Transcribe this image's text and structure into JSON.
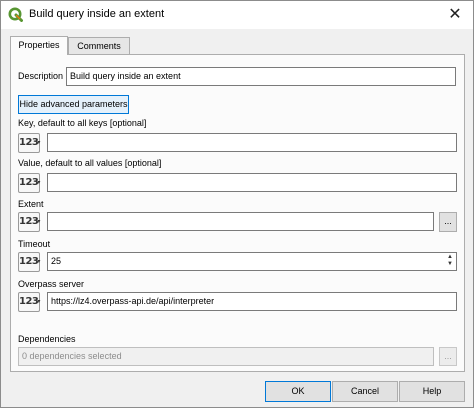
{
  "window": {
    "title": "Build query inside an extent",
    "app_icon": "qgis-logo-icon",
    "close_symbol": "✕"
  },
  "tabs": [
    {
      "label": "Properties",
      "active": true
    },
    {
      "label": "Comments",
      "active": false
    }
  ],
  "description": {
    "label": "Description",
    "value": "Build query inside an extent"
  },
  "advanced_button": {
    "label": "Hide advanced parameters"
  },
  "fields": {
    "key": {
      "label": "Key, default to all keys [optional]",
      "value": "",
      "icon": "123"
    },
    "value": {
      "label": "Value, default to all values [optional]",
      "value": "",
      "icon": "123"
    },
    "extent": {
      "label": "Extent",
      "value": "",
      "icon": "123",
      "browse_label": "..."
    },
    "timeout": {
      "label": "Timeout",
      "value": "25",
      "icon": "123"
    },
    "overpass": {
      "label": "Overpass server",
      "value": "https://lz4.overpass-api.de/api/interpreter",
      "icon": "123"
    }
  },
  "dependencies": {
    "label": "Dependencies",
    "value": "0 dependencies selected",
    "browse_label": "..."
  },
  "buttons": {
    "ok": "OK",
    "cancel": "Cancel",
    "help": "Help"
  },
  "colors": {
    "accent": "#0078d7",
    "qgis_green": "#589632",
    "qgis_yellow": "#ee7913"
  }
}
